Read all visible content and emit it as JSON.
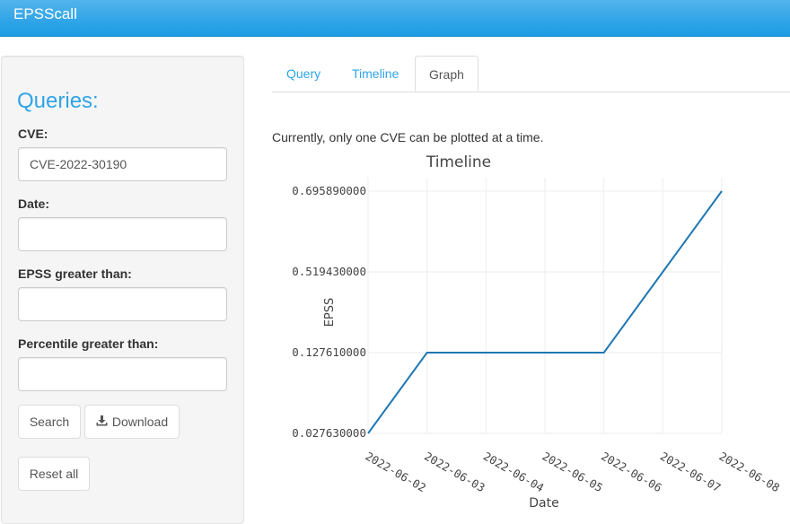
{
  "app": {
    "title": "EPSScall"
  },
  "sidebar": {
    "heading": "Queries:",
    "fields": {
      "cve": {
        "label": "CVE:",
        "value": "CVE-2022-30190"
      },
      "date": {
        "label": "Date:",
        "value": ""
      },
      "epss": {
        "label": "EPSS greater than:",
        "value": ""
      },
      "percentile": {
        "label": "Percentile greater than:",
        "value": ""
      }
    },
    "buttons": {
      "search": "Search",
      "download": "Download",
      "reset": "Reset all"
    }
  },
  "tabs": [
    {
      "label": "Query",
      "active": false
    },
    {
      "label": "Timeline",
      "active": false
    },
    {
      "label": "Graph",
      "active": true
    }
  ],
  "main": {
    "note": "Currently, only one CVE can be plotted at a time."
  },
  "colors": {
    "accent": "#2fa4e7",
    "line": "#1f77b4"
  },
  "chart_data": {
    "type": "line",
    "title": "Timeline",
    "xlabel": "Date",
    "ylabel": "EPSS",
    "y_axis_scale": "categorical",
    "y_categories": [
      "0.027630000",
      "0.127610000",
      "0.519430000",
      "0.695890000"
    ],
    "x_ticks": [
      "2022-06-02",
      "2022-06-03",
      "2022-06-04",
      "2022-06-05",
      "2022-06-06",
      "2022-06-07",
      "2022-06-08"
    ],
    "series": [
      {
        "x": [
          "2022-06-02",
          "2022-06-03",
          "2022-06-06",
          "2022-06-07",
          "2022-06-08"
        ],
        "y": [
          "0.027630000",
          "0.127610000",
          "0.127610000",
          "0.519430000",
          "0.695890000"
        ]
      }
    ],
    "grid": true,
    "legend": "none"
  }
}
